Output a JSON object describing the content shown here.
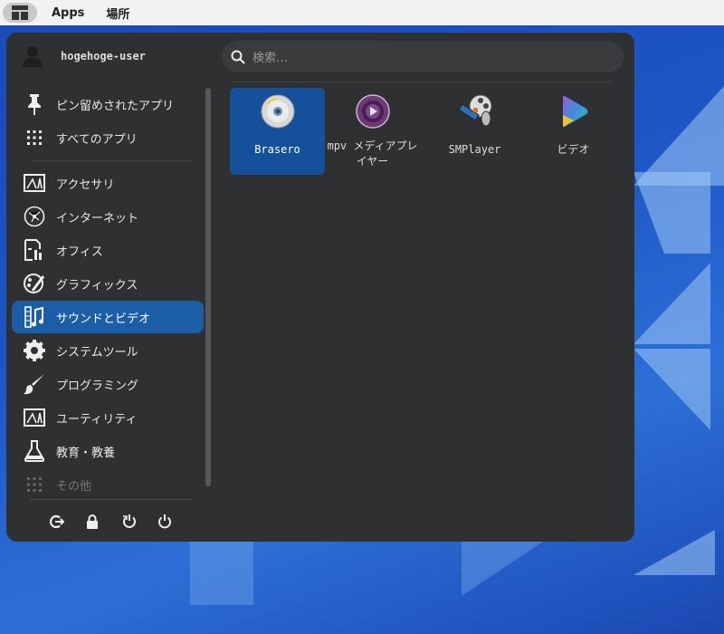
{
  "topbar": {
    "apps": "Apps",
    "places": "場所"
  },
  "user": {
    "name": "hogehoge-user"
  },
  "search": {
    "placeholder": "検索…"
  },
  "sidebar": {
    "items": [
      {
        "label": "ピン留めされたアプリ",
        "icon": "pin-icon"
      },
      {
        "label": "すべてのアプリ",
        "icon": "grid-icon"
      },
      {
        "label": "アクセサリ",
        "icon": "accessories-icon"
      },
      {
        "label": "インターネット",
        "icon": "internet-icon"
      },
      {
        "label": "オフィス",
        "icon": "office-icon"
      },
      {
        "label": "グラフィックス",
        "icon": "graphics-icon"
      },
      {
        "label": "サウンドとビデオ",
        "icon": "multimedia-icon"
      },
      {
        "label": "システムツール",
        "icon": "gear-icon"
      },
      {
        "label": "プログラミング",
        "icon": "brush-icon"
      },
      {
        "label": "ユーティリティ",
        "icon": "utilities-icon"
      },
      {
        "label": "教育・教養",
        "icon": "flask-icon"
      },
      {
        "label": "その他",
        "icon": "grid-icon"
      }
    ]
  },
  "apps": [
    {
      "label": "Brasero"
    },
    {
      "label": "mpv メディアプレイヤー"
    },
    {
      "label": "SMPlayer"
    },
    {
      "label": "ビデオ"
    }
  ],
  "colors": {
    "accent": "#1c5ea6",
    "panel": "#2f3032"
  }
}
